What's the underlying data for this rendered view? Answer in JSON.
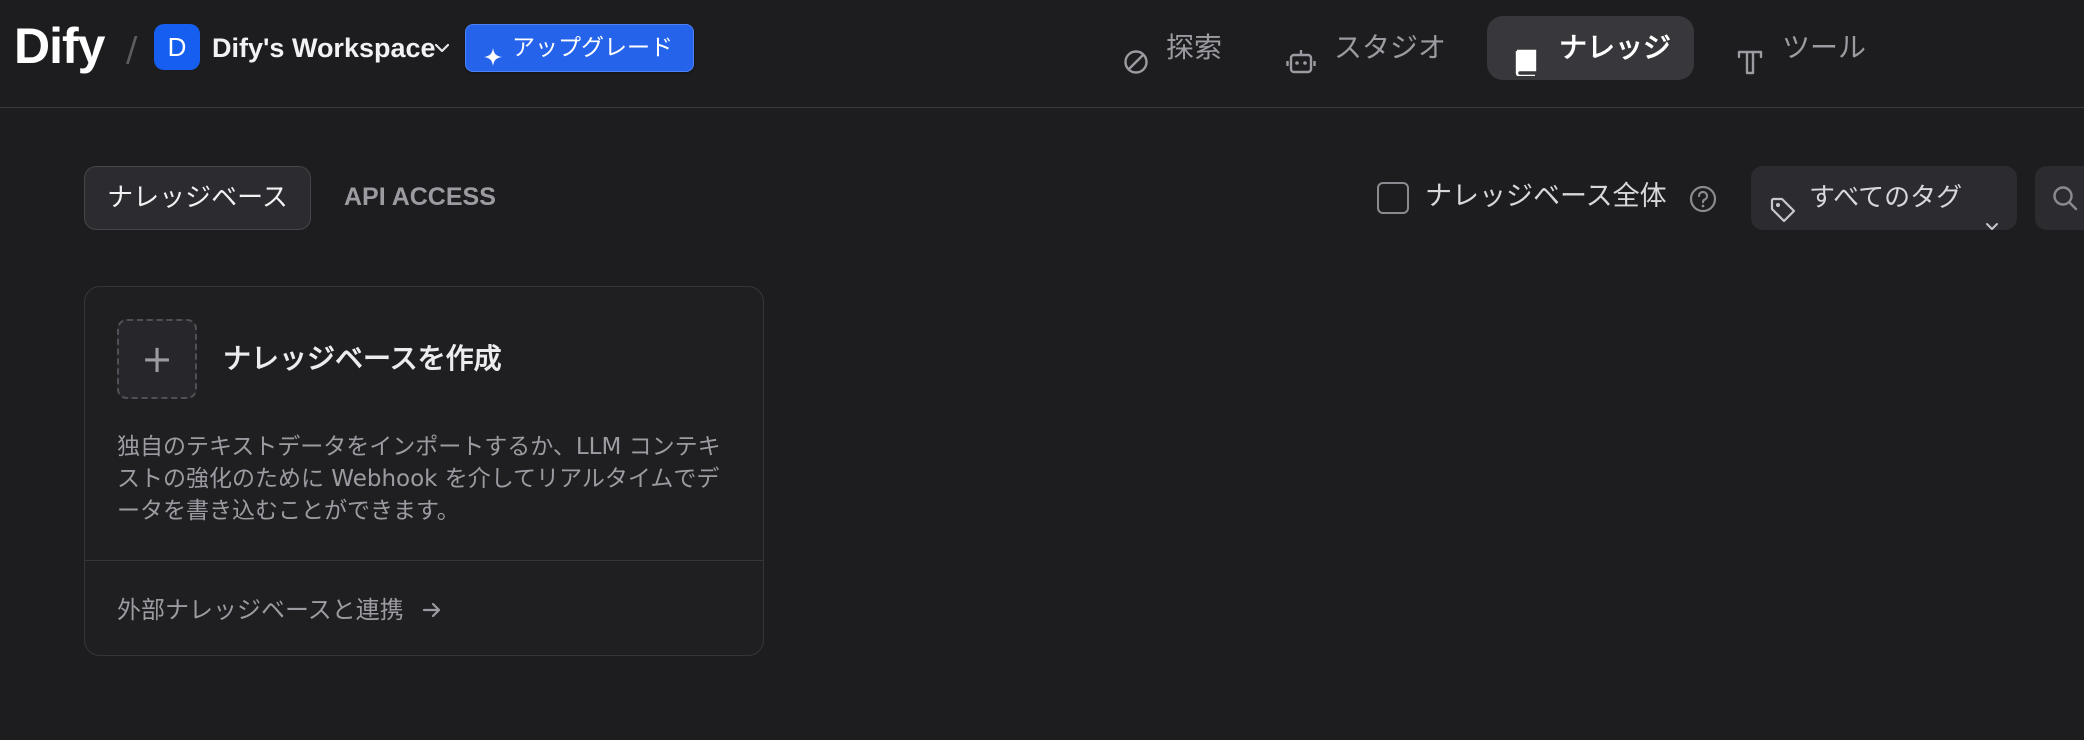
{
  "header": {
    "logo": "Dify",
    "separator": "/",
    "workspace": {
      "avatar_letter": "D",
      "name": "Dify's Workspace",
      "avatar_color": "#155eef"
    },
    "upgrade_label": "アップグレード",
    "nav": [
      {
        "label": "探索",
        "icon": "compass-icon",
        "active": false
      },
      {
        "label": "スタジオ",
        "icon": "robot-icon",
        "active": false
      },
      {
        "label": "ナレッジ",
        "icon": "book-icon",
        "active": true
      },
      {
        "label": "ツール",
        "icon": "tool-icon",
        "active": false
      }
    ]
  },
  "toolbar": {
    "tabs": [
      {
        "label": "ナレッジベース",
        "active": true
      },
      {
        "label": "API ACCESS",
        "active": false
      }
    ],
    "all_kb_checkbox_label": "ナレッジベース全体",
    "all_kb_checked": false,
    "tag_filter_label": "すべてのタグ"
  },
  "create_card": {
    "plus": "+",
    "title": "ナレッジベースを作成",
    "description": "独自のテキストデータをインポートするか、LLM コンテキストの強化のために Webhook を介してリアルタイムでデータを書き込むことができます。",
    "external_link_label": "外部ナレッジベースと連携"
  },
  "colors": {
    "background": "#1d1d1f",
    "accent": "#2563eb",
    "nav_active_bg": "#38383c"
  }
}
